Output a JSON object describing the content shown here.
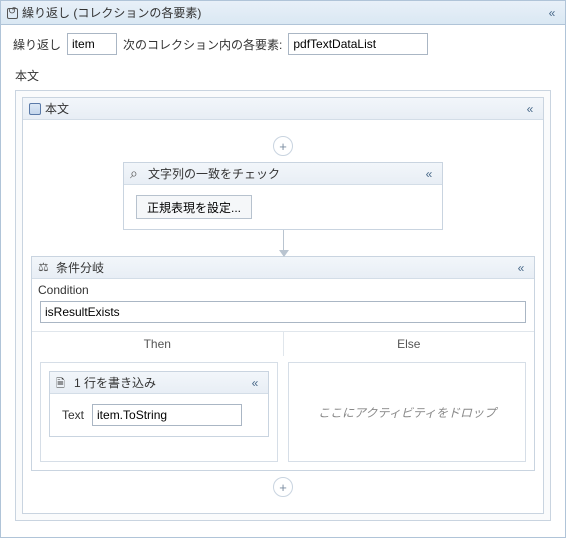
{
  "header": {
    "title": "繰り返し (コレクションの各要素)"
  },
  "params": {
    "repeat_label": "繰り返し",
    "item_value": "item",
    "collection_label": "次のコレクション内の各要素:",
    "collection_value": "pdfTextDataList"
  },
  "body_label": "本文",
  "seq": {
    "title": "本文"
  },
  "check": {
    "title": "文字列の一致をチェック",
    "set_regex_btn": "正規表現を設定..."
  },
  "ifact": {
    "title": "条件分岐",
    "condition_label": "Condition",
    "condition_value": "isResultExists",
    "then_label": "Then",
    "else_label": "Else",
    "drop_hint": "ここにアクティビティをドロップ"
  },
  "writeline": {
    "title": "1 行を書き込み",
    "text_label": "Text",
    "text_value": "item.ToString"
  }
}
